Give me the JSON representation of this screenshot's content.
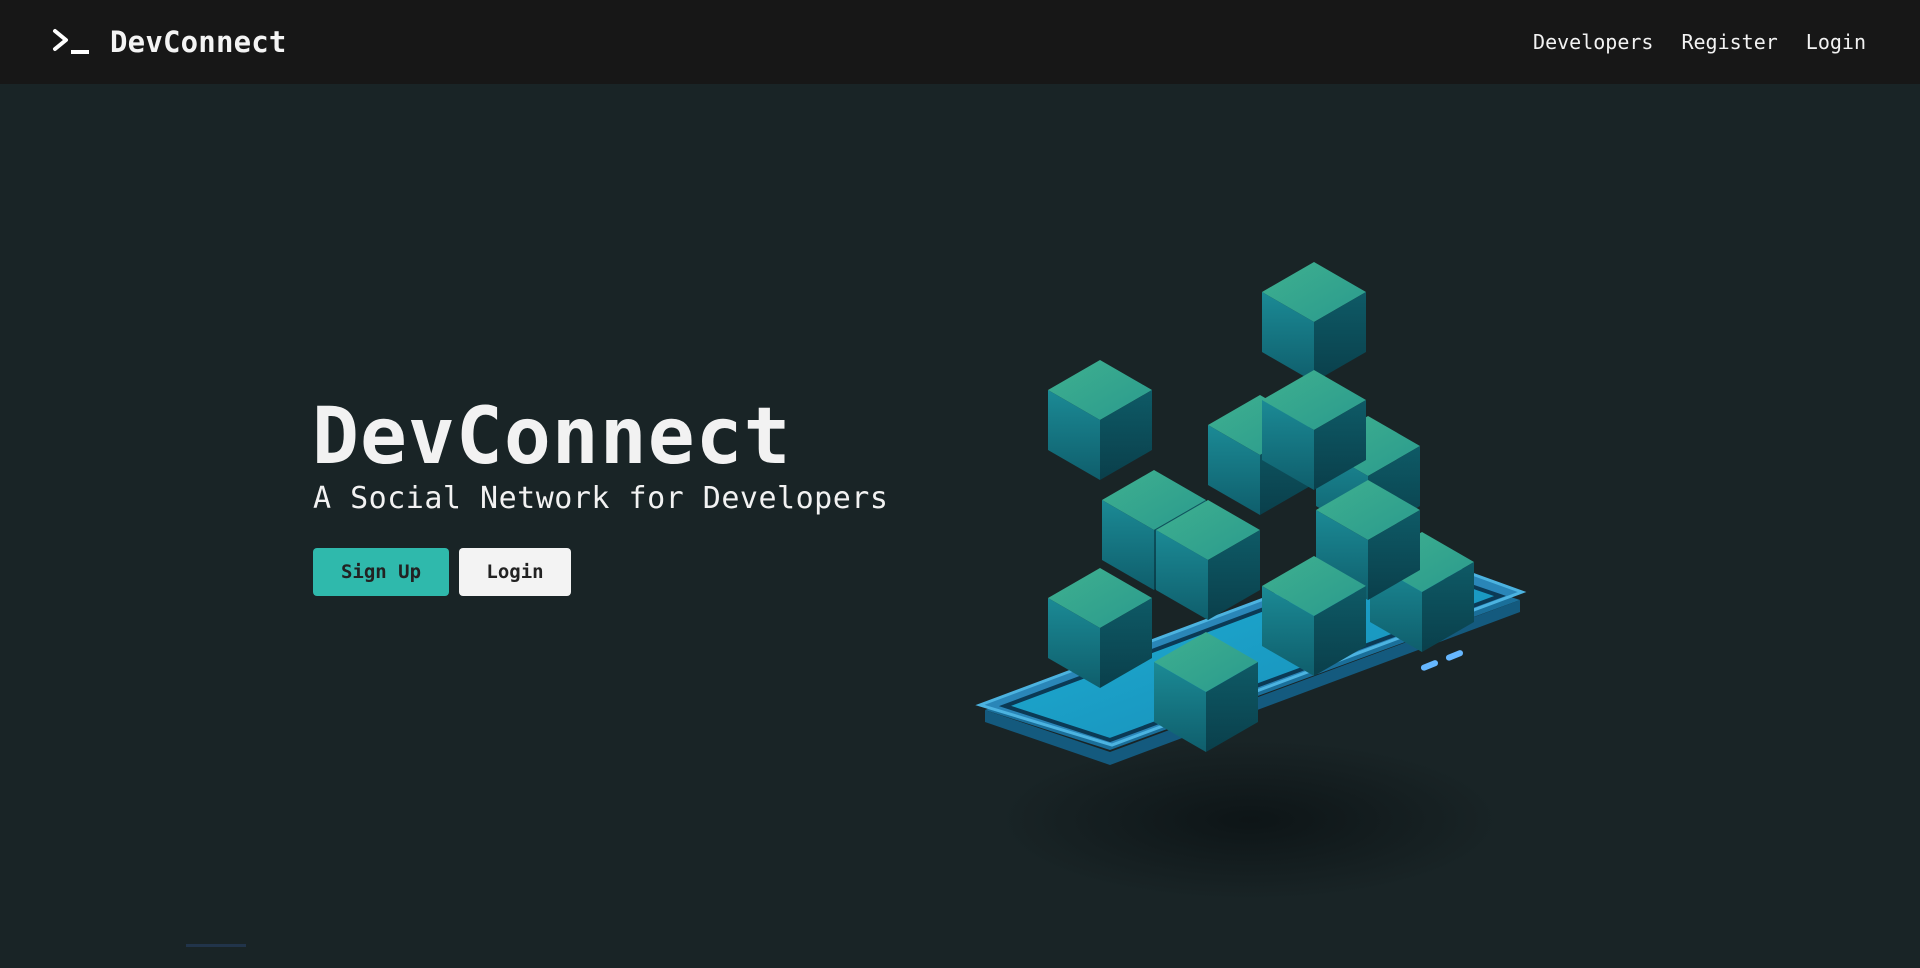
{
  "navbar": {
    "brand_name": "DevConnect",
    "brand_icon": "terminal-prompt-icon",
    "links": [
      {
        "label": "Developers"
      },
      {
        "label": "Register"
      },
      {
        "label": "Login"
      }
    ]
  },
  "hero": {
    "title": "DevConnect",
    "subtitle": "A Social Network for Developers",
    "signup_label": "Sign Up",
    "login_label": "Login",
    "illustration": "isometric-phone-with-cubes-illustration"
  },
  "colors": {
    "navbar_bg": "#171717",
    "page_bg": "#192426",
    "accent": "#2fb9ac",
    "text": "#f2f2f2",
    "button_light": "#f3f3f3"
  }
}
